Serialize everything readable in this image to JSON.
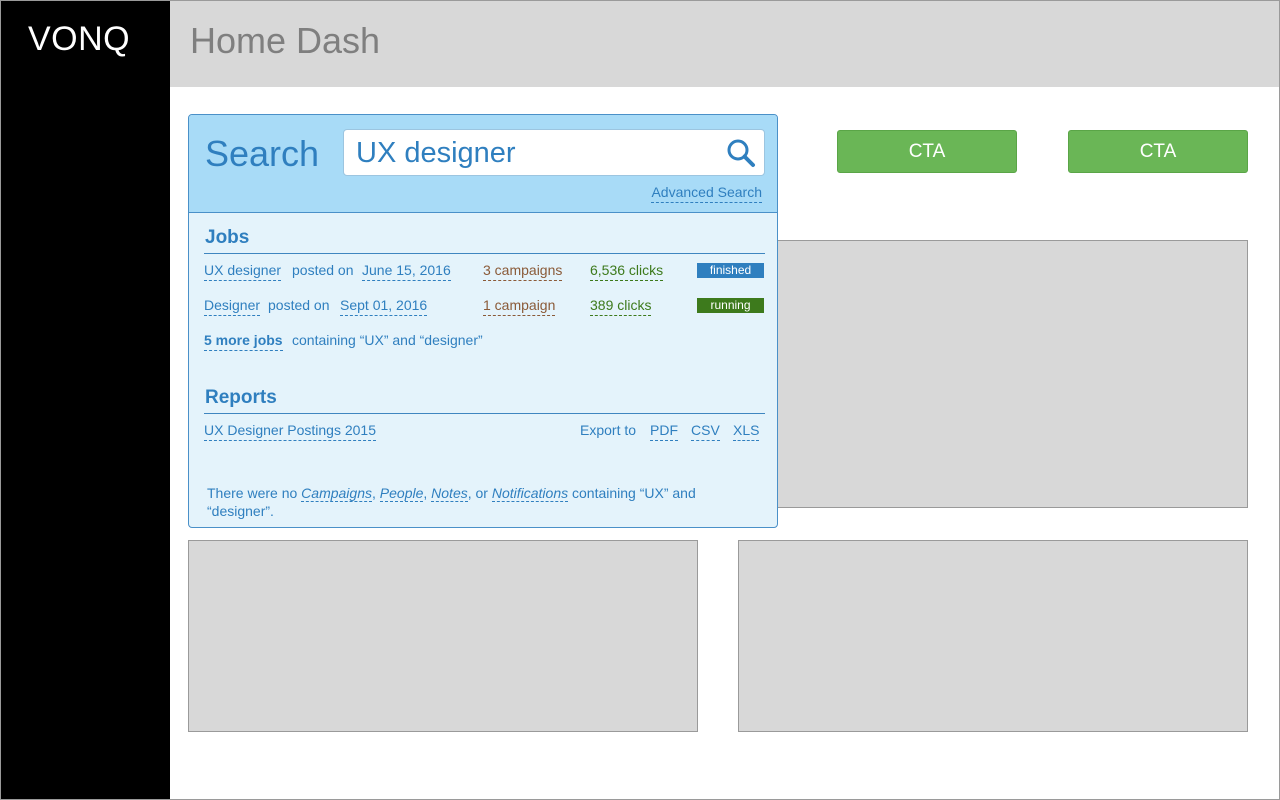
{
  "app": {
    "logo": "VONQ",
    "page_title": "Home Dash"
  },
  "cta": [
    "CTA",
    "CTA"
  ],
  "search": {
    "label": "Search",
    "query": "UX designer",
    "advanced_link": "Advanced Search"
  },
  "jobs": {
    "title": "Jobs",
    "items": [
      {
        "title": "UX designer",
        "posted_label": "posted on",
        "date": "June 15, 2016",
        "campaigns": "3 campaigns",
        "clicks": "6,536 clicks",
        "status": "finished"
      },
      {
        "title": "Designer",
        "posted_label": "posted on",
        "date": "Sept 01, 2016",
        "campaigns": "1 campaign",
        "clicks": "389 clicks",
        "status": "running"
      }
    ],
    "more_link": "5 more jobs",
    "more_text": "containing “UX” and “designer”"
  },
  "reports": {
    "title": "Reports",
    "items": [
      {
        "name": "UX Designer Postings 2015"
      }
    ],
    "export_label": "Export to",
    "formats": [
      "PDF",
      "CSV",
      "XLS"
    ]
  },
  "no_results": {
    "prefix": "There were no",
    "types": [
      "Campaigns",
      "People",
      "Notes",
      "Notifications"
    ],
    "sep1": ",",
    "sep2": ",",
    "sep3": ", or",
    "suffix_line1": "containing “UX” and",
    "suffix_line2": "“designer”."
  },
  "colors": {
    "sidebar": "#000000",
    "header": "#d8d8d8",
    "cta": "#6ab656",
    "panel_head": "#a8dbf7",
    "panel_body": "#e4f3fb",
    "accent": "#2f7fbf",
    "finished": "#2f7fbf",
    "running": "#3d7a1c"
  },
  "icons": {
    "search": "search-icon"
  }
}
